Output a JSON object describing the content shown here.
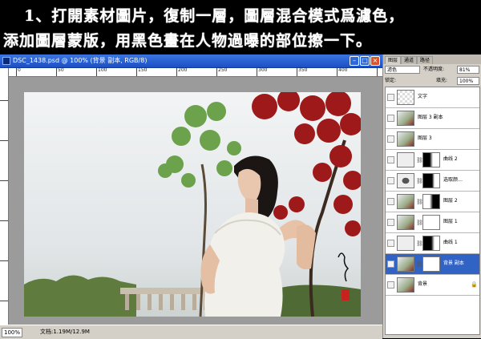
{
  "instructions": {
    "line1": "1、打開素材圖片，復制一層，圖層混合模式爲濾色，",
    "line2": "添加圖層蒙版，用黑色畫在人物過曝的部位擦一下。"
  },
  "document": {
    "title": "DSC_1438.psd @ 100% (背景 副本, RGB/8)",
    "ruler_labels": [
      "0",
      "50",
      "100",
      "150",
      "200",
      "250",
      "300",
      "350",
      "400"
    ],
    "zoom": "100%",
    "status": "文档:1.19M/12.9M"
  },
  "layers_panel": {
    "tabs": [
      "图层",
      "通道",
      "路径"
    ],
    "blend_mode": "滤色",
    "opacity_label": "不透明度:",
    "opacity": "81%",
    "lock_label": "锁定:",
    "fill_label": "填充:",
    "fill": "100%",
    "layers": [
      {
        "name": "文字",
        "kind": "text"
      },
      {
        "name": "图层 3 副本",
        "kind": "image"
      },
      {
        "name": "图层 3",
        "kind": "image"
      },
      {
        "name": "曲线 2",
        "kind": "adjust"
      },
      {
        "name": "选取颜…",
        "kind": "adjust"
      },
      {
        "name": "图层 2",
        "kind": "image-mask"
      },
      {
        "name": "图层 1",
        "kind": "image-mask"
      },
      {
        "name": "曲线 1",
        "kind": "adjust"
      },
      {
        "name": "背景 副本",
        "kind": "image-mask",
        "selected": true
      },
      {
        "name": "背景",
        "kind": "background"
      }
    ]
  },
  "colors": {
    "titlebar": "#1b4fc6",
    "selected_layer": "#3163c5",
    "tree_leaves": "#9e1a1a"
  }
}
